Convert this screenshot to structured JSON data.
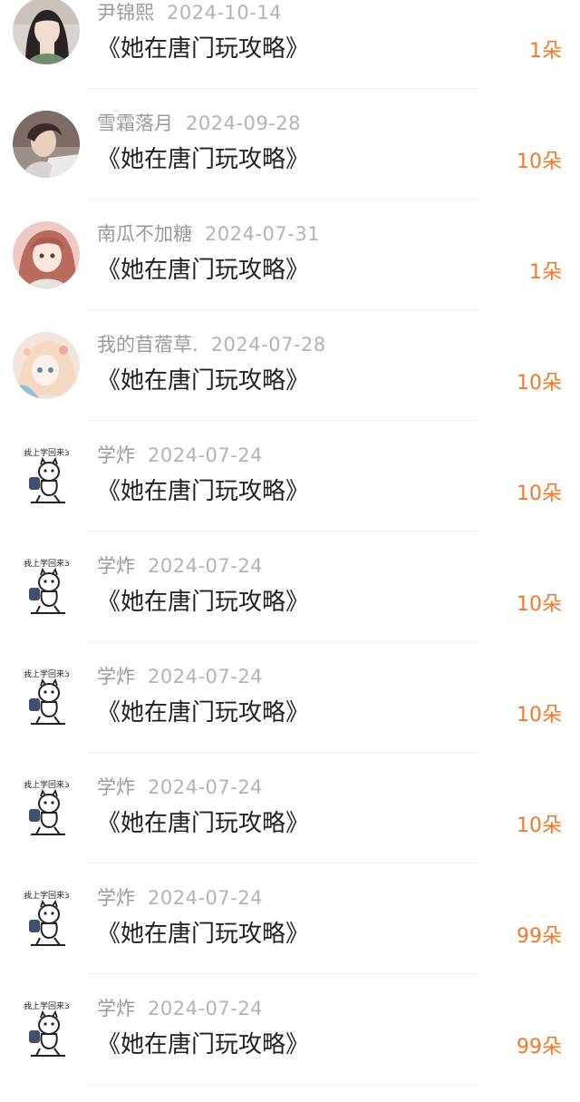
{
  "gifts": [
    {
      "user": "尹锦熙",
      "date": "2024-10-14",
      "book": "《她在唐门玩攻略》",
      "amount": "1朵",
      "avatar": "girl-photo-avatar"
    },
    {
      "user": "雪霜落月",
      "date": "2024-09-28",
      "book": "《她在唐门玩攻略》",
      "amount": "10朵",
      "avatar": "man-photo-avatar"
    },
    {
      "user": "南瓜不加糖",
      "date": "2024-07-31",
      "book": "《她在唐门玩攻略》",
      "amount": "1朵",
      "avatar": "anime-girl-avatar"
    },
    {
      "user": "我的苜蓿草.",
      "date": "2024-07-28",
      "book": "《她在唐门玩攻略》",
      "amount": "10朵",
      "avatar": "anime-elf-avatar"
    },
    {
      "user": "学炸",
      "date": "2024-07-24",
      "book": "《她在唐门玩攻略》",
      "amount": "10朵",
      "avatar": "sketch-cat-avatar",
      "avatar_caption": "我上学回来3"
    },
    {
      "user": "学炸",
      "date": "2024-07-24",
      "book": "《她在唐门玩攻略》",
      "amount": "10朵",
      "avatar": "sketch-cat-avatar",
      "avatar_caption": "我上学回来3"
    },
    {
      "user": "学炸",
      "date": "2024-07-24",
      "book": "《她在唐门玩攻略》",
      "amount": "10朵",
      "avatar": "sketch-cat-avatar",
      "avatar_caption": "我上学回来3"
    },
    {
      "user": "学炸",
      "date": "2024-07-24",
      "book": "《她在唐门玩攻略》",
      "amount": "10朵",
      "avatar": "sketch-cat-avatar",
      "avatar_caption": "我上学回来3"
    },
    {
      "user": "学炸",
      "date": "2024-07-24",
      "book": "《她在唐门玩攻略》",
      "amount": "99朵",
      "avatar": "sketch-cat-avatar",
      "avatar_caption": "我上学回来3"
    },
    {
      "user": "学炸",
      "date": "2024-07-24",
      "book": "《她在唐门玩攻略》",
      "amount": "99朵",
      "avatar": "sketch-cat-avatar",
      "avatar_caption": "我上学回来3"
    }
  ],
  "colors": {
    "amount": "#f2792b",
    "meta": "#9a9a9a",
    "title": "#222222",
    "divider": "#f0f0f0"
  }
}
